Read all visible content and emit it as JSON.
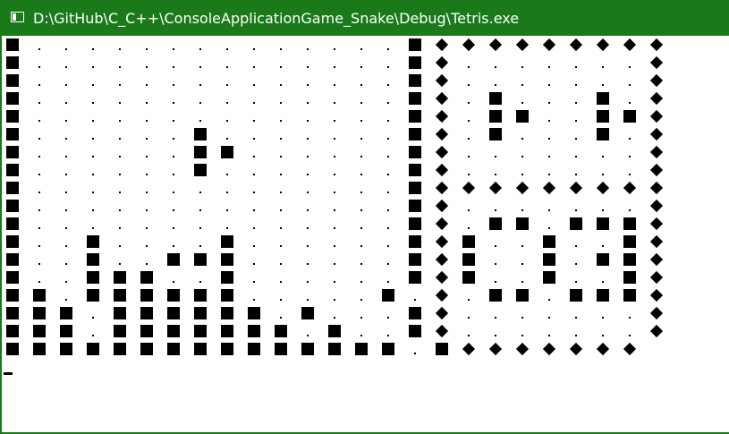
{
  "window": {
    "title": "D:\\GitHub\\C_C++\\ConsoleApplicationGame_Snake\\Debug\\Tetris.exe",
    "icon": "console-window-icon",
    "accent_color": "#1a7a1a"
  },
  "console": {
    "rows": [
      "#..............#*********",
      "#..............#*.......*",
      "#..............#*.......*",
      "#..............#*.#...#.*",
      "#..............#*.##..##*",
      "#......#.......#*.#...#.*",
      "#......##......#*.......*",
      "#......#.......#*.......*",
      "#..............#*********",
      "#..............#*.......*",
      "#..............#*.##.###*",
      "#..#....#......#*#..#..#*",
      "#..#..###......#*#..#.##*",
      "#..###..#......#*#..#..#*",
      "##.######.....#.*.##.###*",
      "###.######.#...#*.......*",
      "###.#######.#..#*.......*",
      "###############.#*******"
    ],
    "legend": {
      "#": "block",
      ".": "empty",
      "*": "border"
    }
  }
}
